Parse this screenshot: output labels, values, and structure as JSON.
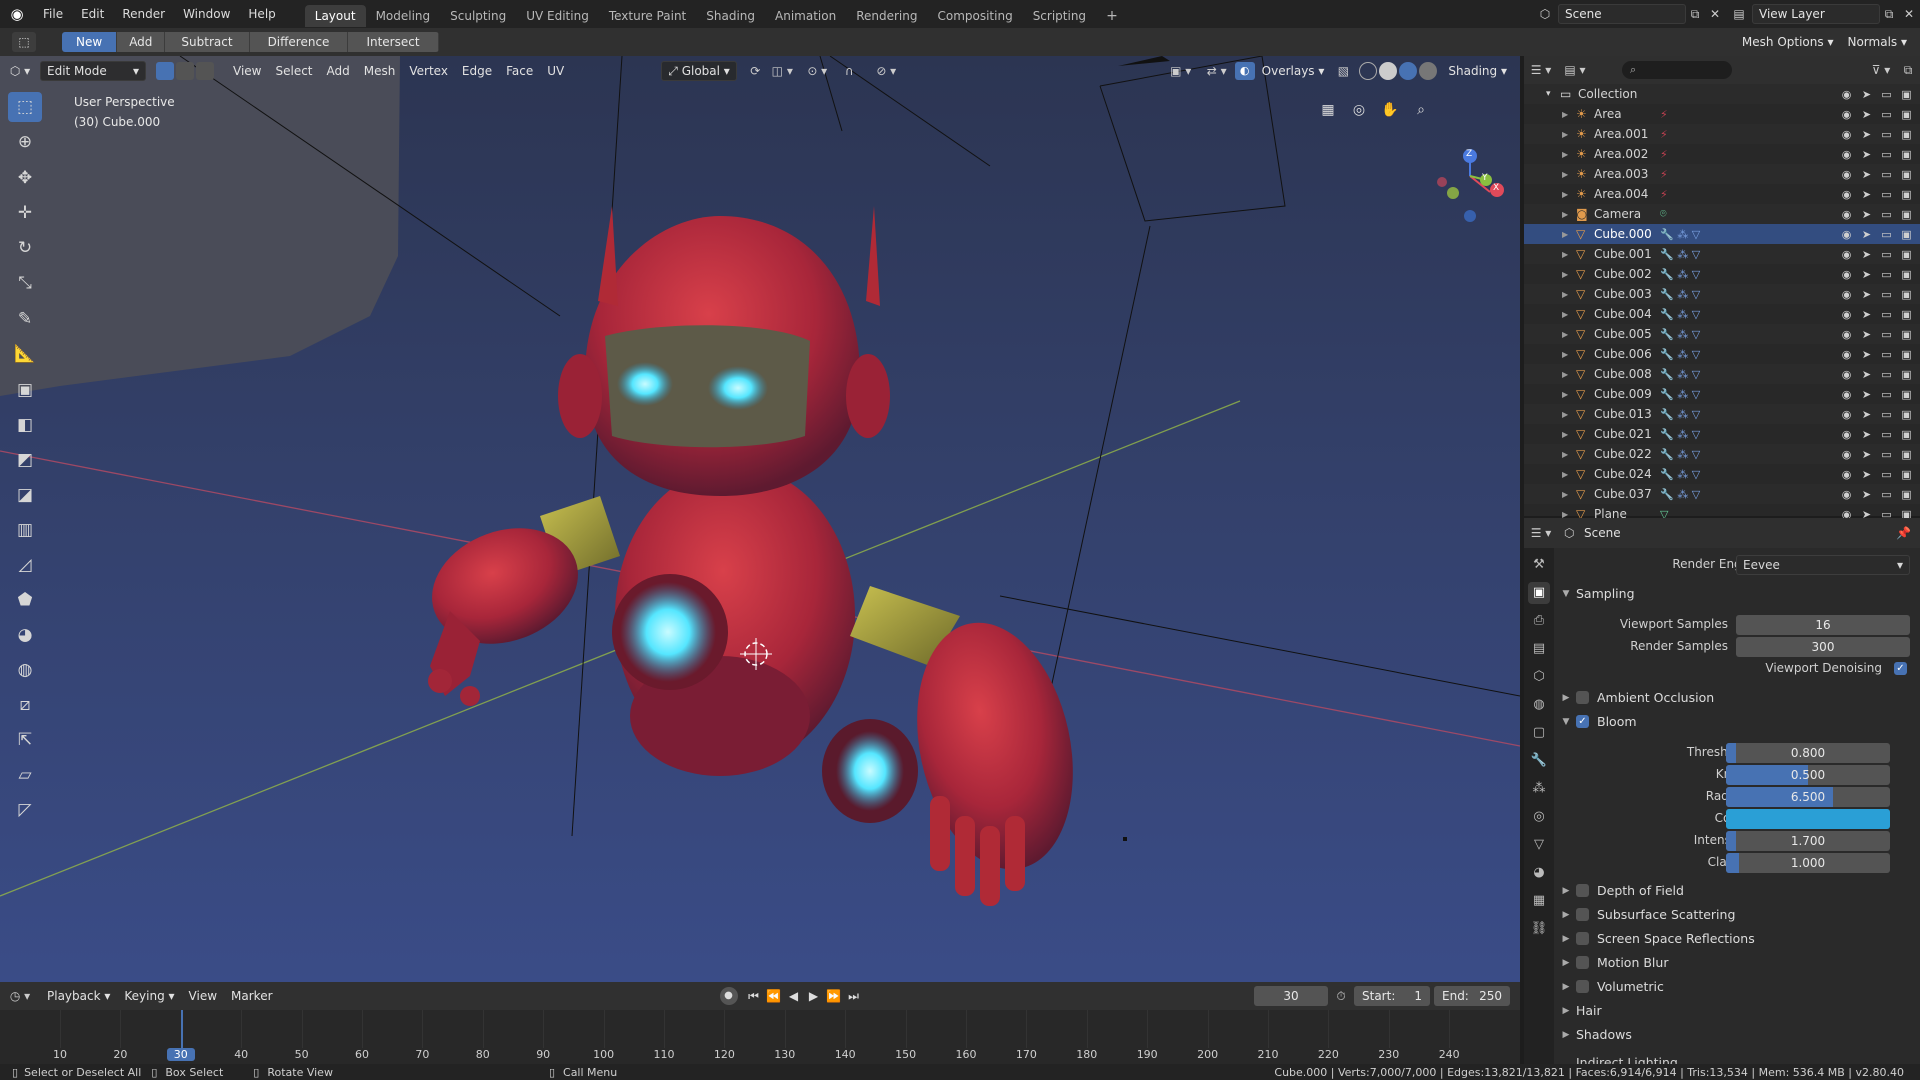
{
  "menubar": {
    "items": [
      "File",
      "Edit",
      "Render",
      "Window",
      "Help"
    ],
    "workspaces": [
      "Layout",
      "Modeling",
      "Sculpting",
      "UV Editing",
      "Texture Paint",
      "Shading",
      "Animation",
      "Rendering",
      "Compositing",
      "Scripting"
    ],
    "active_workspace": "Layout",
    "add_workspace": "+",
    "scene": "Scene",
    "view_layer": "View Layer"
  },
  "toolbar2": {
    "boolean_buttons": [
      "New",
      "Add",
      "Subtract",
      "Difference",
      "Intersect"
    ],
    "mesh_options": "Mesh Options",
    "normals": "Normals"
  },
  "viewport_header": {
    "mode": "Edit Mode",
    "menus": [
      "View",
      "Select",
      "Add",
      "Mesh",
      "Vertex",
      "Edge",
      "Face",
      "UV"
    ],
    "orientation": "Global",
    "overlays": "Overlays",
    "shading": "Shading"
  },
  "viewport": {
    "perspective": "User Perspective",
    "object_info": "(30) Cube.000",
    "gizmo": {
      "z": "Z",
      "y": "Y",
      "x": "X"
    },
    "colors": {
      "bg_top": "#2c3552",
      "bg_bottom": "#3a4c87",
      "robot_red": "#b02a36",
      "glow": "#55e6ff",
      "x_axis": "#c0485a",
      "y_axis": "#8fb04a"
    }
  },
  "outliner": {
    "root": "Collection",
    "items": [
      {
        "name": "Area",
        "type": "light"
      },
      {
        "name": "Area.001",
        "type": "light"
      },
      {
        "name": "Area.002",
        "type": "light"
      },
      {
        "name": "Area.003",
        "type": "light"
      },
      {
        "name": "Area.004",
        "type": "light"
      },
      {
        "name": "Camera",
        "type": "camera"
      },
      {
        "name": "Cube.000",
        "type": "mesh",
        "selected": true
      },
      {
        "name": "Cube.001",
        "type": "mesh"
      },
      {
        "name": "Cube.002",
        "type": "mesh"
      },
      {
        "name": "Cube.003",
        "type": "mesh"
      },
      {
        "name": "Cube.004",
        "type": "mesh"
      },
      {
        "name": "Cube.005",
        "type": "mesh"
      },
      {
        "name": "Cube.006",
        "type": "mesh"
      },
      {
        "name": "Cube.008",
        "type": "mesh"
      },
      {
        "name": "Cube.009",
        "type": "mesh"
      },
      {
        "name": "Cube.013",
        "type": "mesh"
      },
      {
        "name": "Cube.021",
        "type": "mesh"
      },
      {
        "name": "Cube.022",
        "type": "mesh"
      },
      {
        "name": "Cube.024",
        "type": "mesh"
      },
      {
        "name": "Cube.037",
        "type": "mesh"
      },
      {
        "name": "Plane",
        "type": "mesh"
      }
    ]
  },
  "properties": {
    "context": "Scene",
    "render_engine_label": "Render Engine",
    "render_engine": "Eevee",
    "sampling": {
      "title": "Sampling",
      "viewport_samples_label": "Viewport Samples",
      "viewport_samples": "16",
      "render_samples_label": "Render Samples",
      "render_samples": "300",
      "denoise_label": "Viewport Denoising"
    },
    "ambient_occlusion": "Ambient Occlusion",
    "bloom": {
      "title": "Bloom",
      "fields": [
        {
          "label": "Threshold",
          "value": "0.800",
          "fill": 0.06
        },
        {
          "label": "Knee",
          "value": "0.500",
          "fill": 0.5
        },
        {
          "label": "Radius",
          "value": "6.500",
          "fill": 0.65
        },
        {
          "label": "Color",
          "value": "",
          "fill": 1.0
        },
        {
          "label": "Intensity",
          "value": "1.700",
          "fill": 0.0
        },
        {
          "label": "Clamp",
          "value": "1.000",
          "fill": 0.08
        }
      ]
    },
    "panels": [
      "Depth of Field",
      "Subsurface Scattering",
      "Screen Space Reflections",
      "Motion Blur",
      "Volumetric"
    ],
    "plain_panels": [
      "Hair",
      "Shadows"
    ],
    "cut_panel": "Indirect Lighting"
  },
  "timeline": {
    "menus": [
      "Playback",
      "Keying",
      "View",
      "Marker"
    ],
    "current_frame": "30",
    "start_label": "Start:",
    "start": "1",
    "end_label": "End:",
    "end": "250",
    "ticks": [
      "10",
      "20",
      "30",
      "40",
      "50",
      "60",
      "70",
      "80",
      "90",
      "100",
      "110",
      "120",
      "130",
      "140",
      "150",
      "160",
      "170",
      "180",
      "190",
      "200",
      "210",
      "220",
      "230",
      "240"
    ]
  },
  "statusbar": {
    "select": "Select or Deselect All",
    "box": "Box Select",
    "rotate": "Rotate View",
    "call_menu": "Call Menu",
    "stats": "Cube.000 | Verts:7,000/7,000 | Edges:13,821/13,821 | Faces:6,914/6,914 | Tris:13,534 | Mem: 536.4 MB | v2.80.40"
  }
}
